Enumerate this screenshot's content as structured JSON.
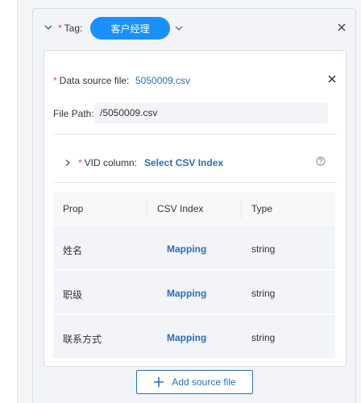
{
  "tag": {
    "required_mark": "*",
    "label": "Tag:",
    "value": "客户经理"
  },
  "data_source": {
    "required_mark": "*",
    "label": "Data source file:",
    "file_name": "5050009.csv",
    "file_path_label": "File Path:",
    "file_path_value": "/5050009.csv"
  },
  "vid": {
    "required_mark": "*",
    "label": "VID column:",
    "select_label": "Select CSV Index"
  },
  "table": {
    "headers": [
      "Prop",
      "CSV Index",
      "Type"
    ],
    "rows": [
      {
        "prop": "姓名",
        "csv_index": "Mapping",
        "type": "string"
      },
      {
        "prop": "职级",
        "csv_index": "Mapping",
        "type": "string"
      },
      {
        "prop": "联系方式",
        "csv_index": "Mapping",
        "type": "string"
      }
    ]
  },
  "add_source_label": "Add source file",
  "colors": {
    "accent": "#1a90ff",
    "link": "#2a6fb8",
    "required": "#e5484d"
  },
  "icons": [
    "chevron-down-icon",
    "close-icon",
    "chevron-right-icon",
    "help-icon",
    "plus-icon"
  ]
}
